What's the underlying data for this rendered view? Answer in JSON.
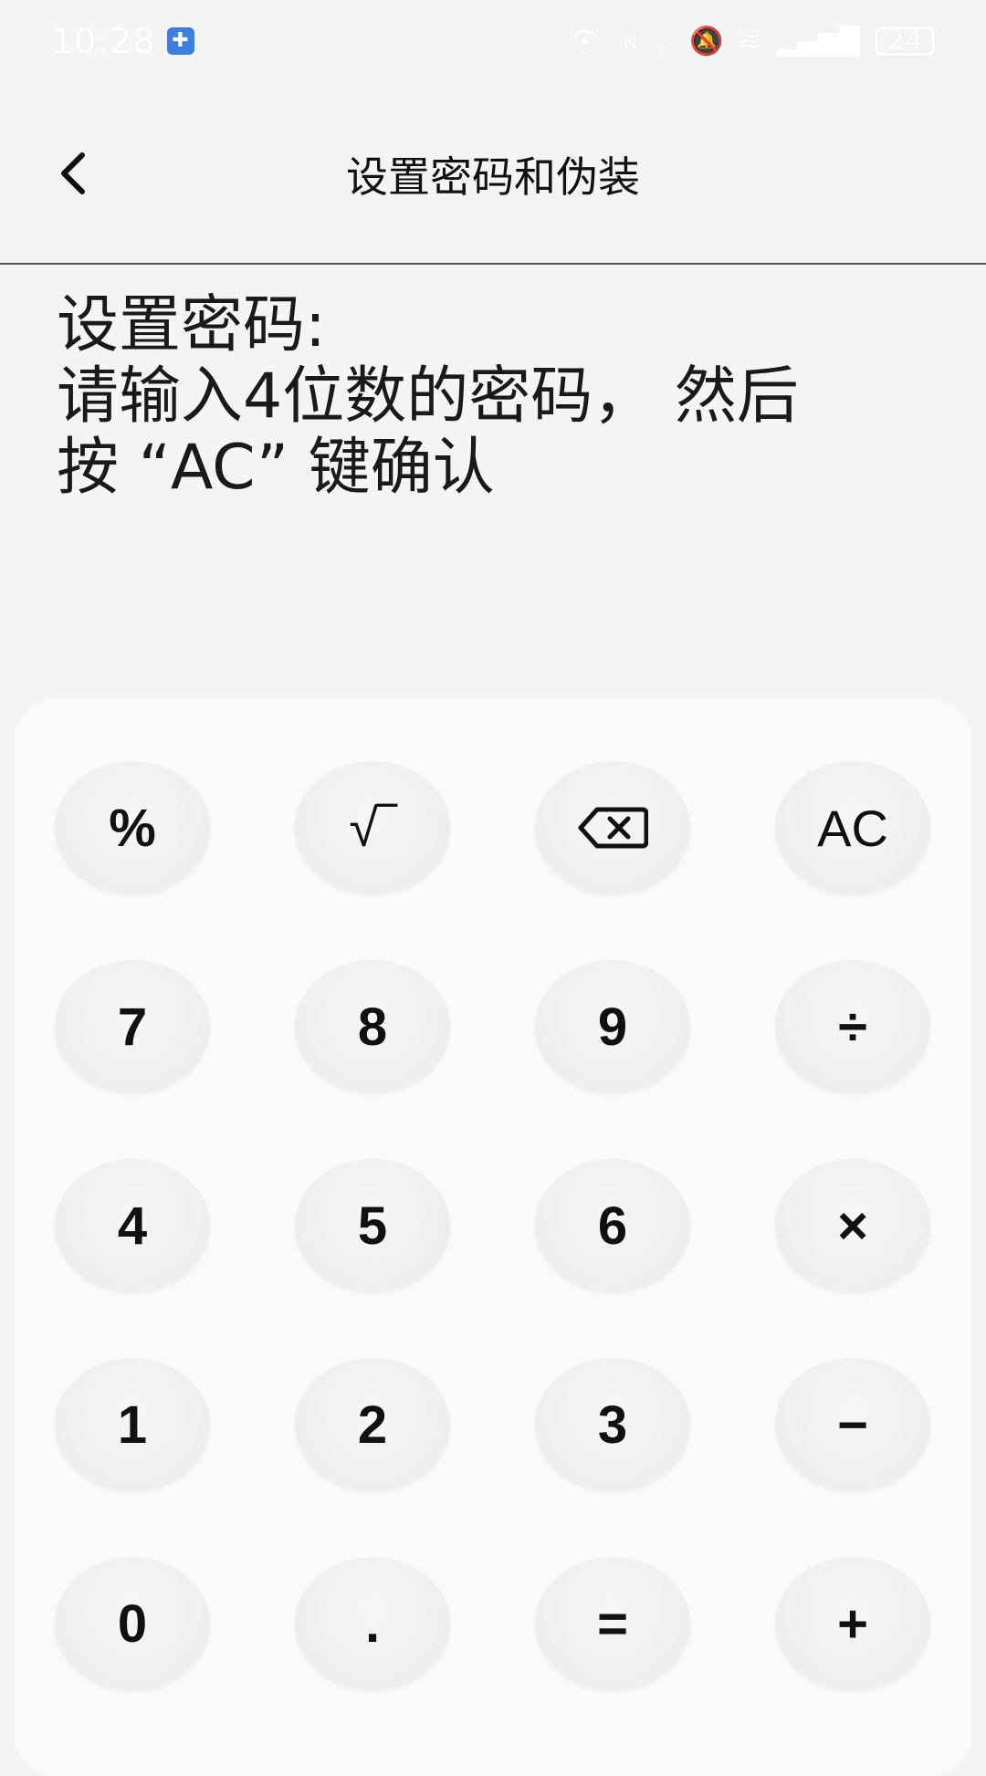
{
  "status_bar": {
    "time": "10:28",
    "battery": "24"
  },
  "header": {
    "title": "设置密码和伪装"
  },
  "instructions": {
    "line1": "设置密码:",
    "line2": "请输入4位数的密码， 然后",
    "line3": "按 “AC” 键确认"
  },
  "keypad": {
    "rows": [
      [
        "%",
        "√‾",
        "backspace",
        "AC"
      ],
      [
        "7",
        "8",
        "9",
        "÷"
      ],
      [
        "4",
        "5",
        "6",
        "×"
      ],
      [
        "1",
        "2",
        "3",
        "−"
      ],
      [
        "0",
        ".",
        "=",
        "+"
      ]
    ],
    "percent": "%",
    "sqrt": "√‾",
    "ac": "AC",
    "seven": "7",
    "eight": "8",
    "nine": "9",
    "divide": "÷",
    "four": "4",
    "five": "5",
    "six": "6",
    "multiply": "×",
    "one": "1",
    "two": "2",
    "three": "3",
    "minus": "−",
    "zero": "0",
    "dot": ".",
    "equals": "=",
    "plus": "+"
  },
  "icons": {
    "back": "chevron-left-icon",
    "backspace": "backspace-icon",
    "app": "puzzle-icon",
    "eye": "eye-icon",
    "nfc": "nfc-icon",
    "bluetooth": "bluetooth-icon",
    "mute": "mute-icon",
    "wifi": "wifi-icon",
    "signal": "signal-icon"
  }
}
